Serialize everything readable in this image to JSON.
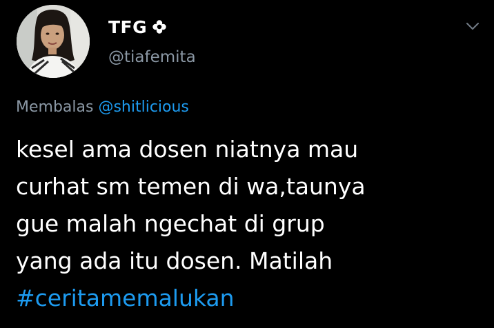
{
  "author": {
    "display_name": "TFG",
    "badge_icon": "flower-icon",
    "handle": "@tiafemita",
    "avatar_icon": "profile-photo"
  },
  "header": {
    "menu_icon": "chevron-down-icon"
  },
  "reply": {
    "prefix": "Membalas",
    "to_handle": "@shitlicious"
  },
  "tweet": {
    "lines": [
      "kesel ama dosen niatnya mau",
      "curhat sm temen di wa,taunya",
      "gue malah ngechat di grup",
      "yang ada itu dosen. Matilah"
    ],
    "hashtag": "#ceritamemalukan"
  },
  "colors": {
    "background": "#000000",
    "text": "#ffffff",
    "secondary_text": "#8b98a5",
    "link": "#1d9bf0"
  }
}
